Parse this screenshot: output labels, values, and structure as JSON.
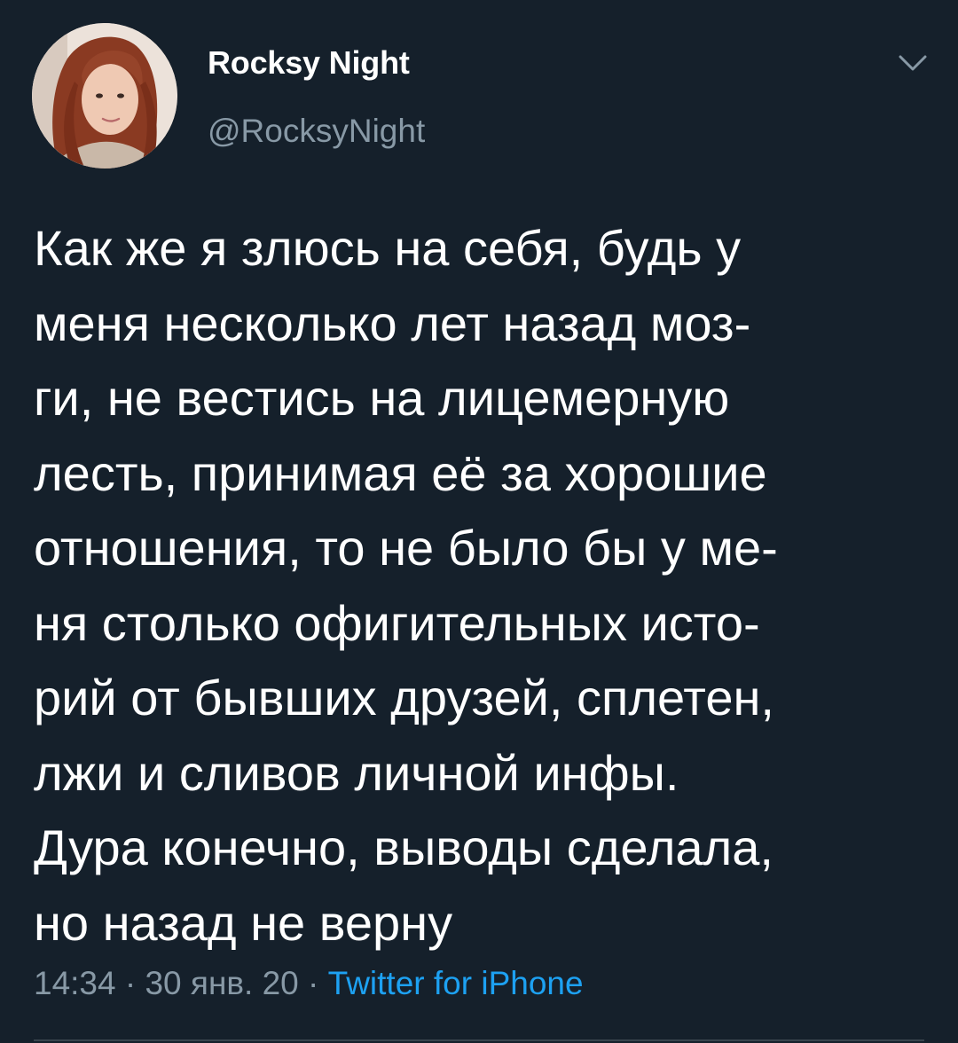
{
  "user": {
    "display_name": "Rocksy Night",
    "handle": "@RocksyNight"
  },
  "icons": {
    "more": "chevron-down-icon"
  },
  "tweet": {
    "lines": [
      "Как же я злюсь на себя, будь у",
      "меня несколько лет назад моз-",
      "ги, не вестись на лицемерную",
      "лесть, принимая её за хорошие",
      "отношения, то не было бы у ме-",
      "ня столько офигительных исто-",
      "рий от бывших друзей, сплетен,",
      "лжи и сливов личной инфы.",
      "Дура конечно, выводы сделала,",
      "но назад не верну"
    ]
  },
  "meta": {
    "time": "14:34",
    "separator": " · ",
    "date": "30 янв. 20",
    "source": "Twitter for iPhone"
  },
  "colors": {
    "background": "#15202b",
    "text": "#ffffff",
    "secondary": "#8899a6",
    "link": "#1da1f2"
  }
}
